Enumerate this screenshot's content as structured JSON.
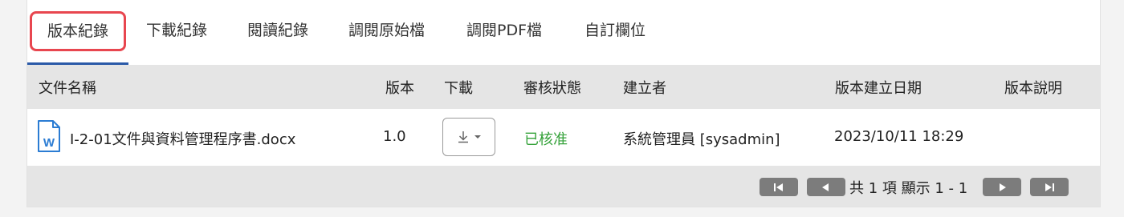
{
  "tabs": [
    {
      "label": "版本紀錄",
      "active": true
    },
    {
      "label": "下載紀錄"
    },
    {
      "label": "閱讀紀錄"
    },
    {
      "label": "調閱原始檔"
    },
    {
      "label": "調閱PDF檔"
    },
    {
      "label": "自訂欄位"
    }
  ],
  "table": {
    "columns": {
      "filename": "文件名稱",
      "version": "版本",
      "download": "下載",
      "review_status": "審核狀態",
      "creator": "建立者",
      "created_date": "版本建立日期",
      "note": "版本說明"
    },
    "rows": [
      {
        "file_icon": "word-docx-icon",
        "filename": "I-2-01文件與資料管理程序書.docx",
        "version": "1.0",
        "download_icon": "download-icon",
        "review_status": "已核准",
        "creator": "系統管理員 [sysadmin]",
        "created_date": "2023/10/11 18:29",
        "note": ""
      }
    ]
  },
  "pagination": {
    "summary": "共 1 項 顯示 1 - 1"
  },
  "colors": {
    "highlight_border": "#e8464f",
    "active_underline": "#2b5aa8",
    "approved_text": "#35a23a",
    "header_bg": "#e5e5e5",
    "pager_button": "#7c7c7c",
    "word_icon_blue": "#2b7cd3"
  }
}
